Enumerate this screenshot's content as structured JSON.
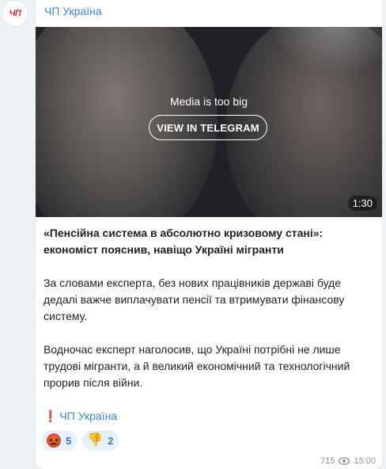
{
  "avatar": {
    "text": "ЧП"
  },
  "post": {
    "channel_name": "ЧП Україна",
    "media": {
      "notice": "Media is too big",
      "button_label": "VIEW IN TELEGRAM",
      "duration": "1:30"
    },
    "title": "«Пенсійна система в абсолютно кризовому стані»: економіст пояснив, навіщо Україні мігранти",
    "paragraph1": "За словами експерта, без нових працівників державі буде дедалі важче виплачувати пенсії та втримувати фінансову систему.",
    "paragraph2": "Водночас експерт наголосив, що Україні потрібні не лише трудові мігранти, а й великий економічний та технологічний прорив після війни.",
    "signature": {
      "mark": "❗",
      "link": "ЧП Україна"
    },
    "reactions": [
      {
        "emoji": "angry-face",
        "count": "5"
      },
      {
        "emoji": "thumbs-down",
        "count": "2"
      }
    ],
    "views": "715",
    "time": "15:00"
  },
  "colors": {
    "link": "#3a8ad6",
    "background": "#eef2f5",
    "reaction_bg": "#e7f1fb"
  }
}
